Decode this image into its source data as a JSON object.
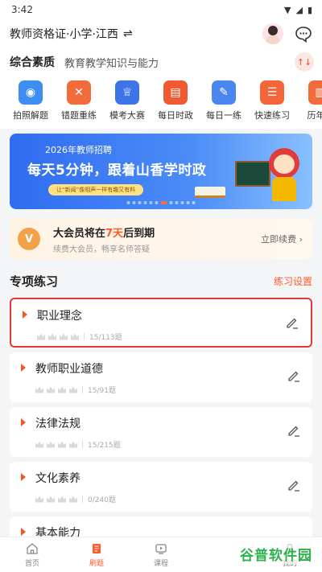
{
  "status": {
    "time": "3:42"
  },
  "header": {
    "exam_title": "教师资格证·小学·江西",
    "switch_symbol": "⇌"
  },
  "subjects": {
    "active": "综合素质",
    "other": "教育教学知识与能力",
    "sort_symbol": "↑↓"
  },
  "tools": [
    {
      "label": "拍照解题",
      "icon": "camera-icon",
      "color": "#3d8ef0"
    },
    {
      "label": "错题重练",
      "icon": "wrong-questions-icon",
      "color": "#f26b3a"
    },
    {
      "label": "模考大赛",
      "icon": "trophy-icon",
      "color": "#3d74e8"
    },
    {
      "label": "每日时政",
      "icon": "news-icon",
      "color": "#f05a30"
    },
    {
      "label": "每日一练",
      "icon": "pen-icon",
      "color": "#4a86f0"
    },
    {
      "label": "快速练习",
      "icon": "quick-practice-icon",
      "color": "#f4663a"
    },
    {
      "label": "历年真",
      "icon": "past-papers-icon",
      "color": "#f26b3a"
    }
  ],
  "banner": {
    "top_text": "2026年教师招聘",
    "main_text": "每天5分钟，跟着山香学时政",
    "pill_text": "让“新闻”像相声一样有趣又有料"
  },
  "vip": {
    "badge": "V",
    "title_prefix": "大会员将在",
    "title_highlight": "7天",
    "title_suffix": "后到期",
    "subtitle": "续费大会员，畅享名师答疑",
    "renew": "立即续费 ›"
  },
  "section": {
    "title": "专项练习",
    "settings": "练习设置"
  },
  "practice": [
    {
      "name": "职业理念",
      "progress": "15/113题"
    },
    {
      "name": "教师职业道德",
      "progress": "15/91题"
    },
    {
      "name": "法律法规",
      "progress": "15/215题"
    },
    {
      "name": "文化素养",
      "progress": "0/240题"
    },
    {
      "name": "基本能力",
      "progress": ""
    }
  ],
  "tabbar": [
    {
      "label": "首页",
      "icon": "home-icon"
    },
    {
      "label": "刷题",
      "icon": "practice-book-icon",
      "active": true
    },
    {
      "label": "课程",
      "icon": "course-play-icon"
    },
    {
      "label": "",
      "icon": ""
    },
    {
      "label": "我的",
      "icon": "profile-icon"
    }
  ],
  "watermark": "谷普软件园",
  "colors": {
    "accent": "#ff5a2a",
    "selected_border": "#e53935",
    "banner_blue": "#2f6cf0"
  }
}
